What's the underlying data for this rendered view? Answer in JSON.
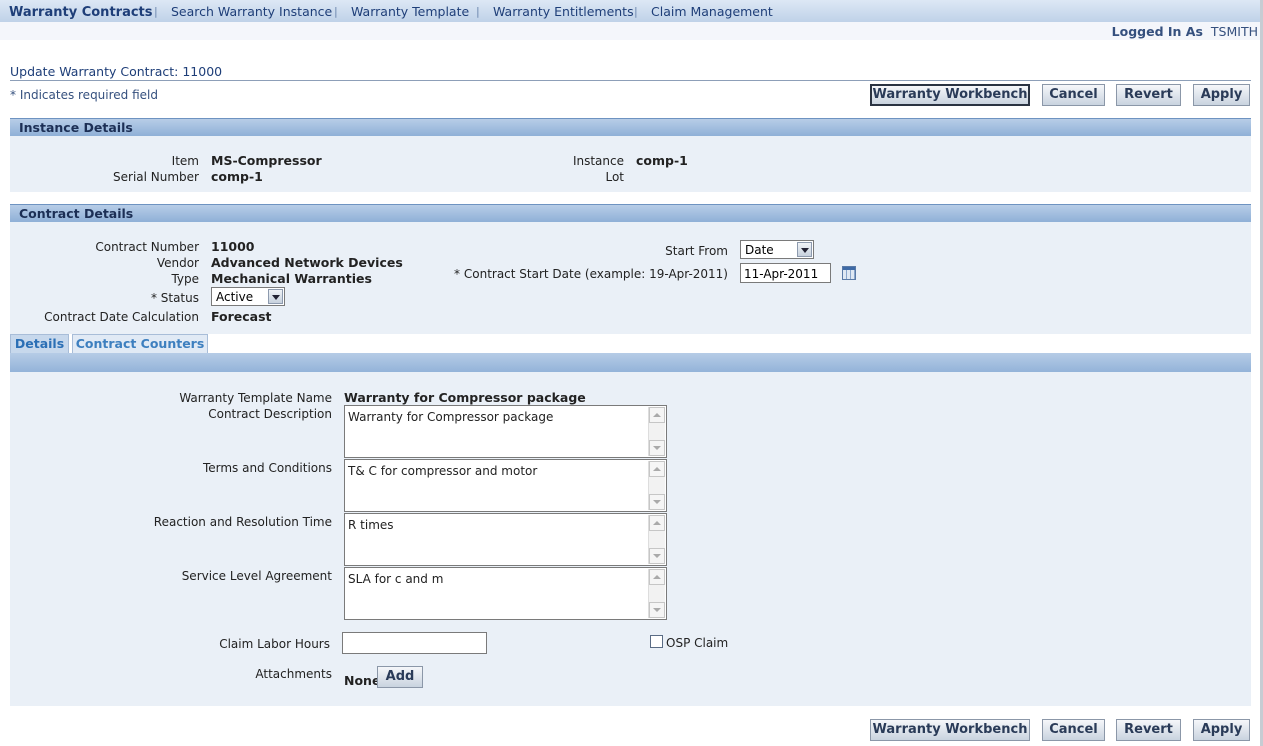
{
  "nav": {
    "tabs": [
      "Warranty Contracts",
      "Search Warranty Instance",
      "Warranty Template",
      "Warranty Entitlements",
      "Claim Management"
    ],
    "separator": "|"
  },
  "user": {
    "logged_in_label": "Logged In As",
    "username": "TSMITH"
  },
  "page": {
    "title": "Update Warranty Contract: 11000",
    "required_note": "*  Indicates required field"
  },
  "buttons": {
    "workbench": "Warranty Workbench",
    "cancel": "Cancel",
    "revert": "Revert",
    "apply": "Apply"
  },
  "instance": {
    "header": "Instance Details",
    "item_label": "Item",
    "item_value": "MS-Compressor",
    "serial_label": "Serial Number",
    "serial_value": "comp-1",
    "instance_label": "Instance",
    "instance_value": "comp-1",
    "lot_label": "Lot",
    "lot_value": ""
  },
  "contract": {
    "header": "Contract Details",
    "number_label": "Contract Number",
    "number_value": "11000",
    "vendor_label": "Vendor",
    "vendor_value": "Advanced Network Devices",
    "type_label": "Type",
    "type_value": "Mechanical Warranties",
    "status_label": "* Status",
    "status_value": "Active",
    "date_calc_label": "Contract Date Calculation",
    "date_calc_value": "Forecast",
    "start_from_label": "Start From",
    "start_from_value": "Date",
    "start_date_label": "* Contract Start Date (example: 19-Apr-2011)",
    "start_date_value": "11-Apr-2011"
  },
  "tabs": {
    "details": "Details",
    "counters": "Contract Counters"
  },
  "details": {
    "template_label": "Warranty Template Name",
    "template_value": "Warranty for Compressor package",
    "description_label": "Contract Description",
    "description_value": "Warranty for Compressor package",
    "terms_label": "Terms and Conditions",
    "terms_value": "T& C for compressor and motor",
    "reaction_label": "Reaction and Resolution Time",
    "reaction_value": "R times",
    "sla_label": "Service Level Agreement",
    "sla_value": "SLA for c and m",
    "labor_label": "Claim Labor Hours",
    "labor_value": "",
    "osp_label": "OSP Claim",
    "attachments_label": "Attachments",
    "attachments_value": "None",
    "add_button": "Add"
  }
}
